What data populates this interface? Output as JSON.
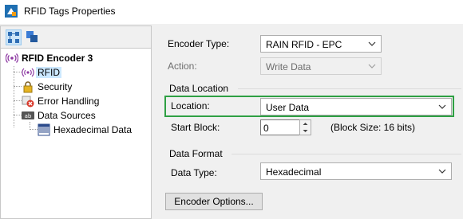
{
  "window": {
    "title": "RFID Tags Properties"
  },
  "tree": {
    "root": "RFID Encoder 3",
    "items": [
      "RFID",
      "Security",
      "Error Handling",
      "Data Sources"
    ],
    "sub_item": "Hexadecimal Data"
  },
  "form": {
    "encoder_type_label": "Encoder Type:",
    "encoder_type_value": "RAIN RFID - EPC",
    "action_label": "Action:",
    "action_value": "Write Data",
    "data_location_title": "Data Location",
    "location_label": "Location:",
    "location_value": "User Data",
    "start_block_label": "Start Block:",
    "start_block_value": "0",
    "block_size_text": "(Block Size:  16 bits)",
    "data_format_title": "Data Format",
    "data_type_label": "Data Type:",
    "data_type_value": "Hexadecimal",
    "encoder_options_button": "Encoder Options..."
  },
  "colors": {
    "highlight": "#2ea043",
    "selection": "#cce8ff"
  }
}
